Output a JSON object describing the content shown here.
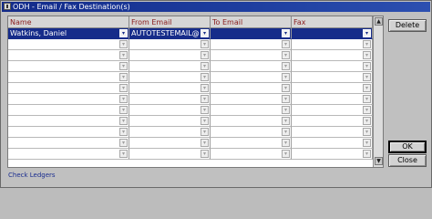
{
  "window": {
    "title": "ODH - Email / Fax Destination(s)"
  },
  "grid": {
    "columns": [
      "Name",
      "From Email",
      "To Email",
      "Fax"
    ],
    "rows": [
      {
        "name": "Watkins, Daniel",
        "from_email": "AUTOTESTEMAIL@MIC",
        "to_email": "",
        "fax": "",
        "selected": true
      },
      {
        "name": "",
        "from_email": "",
        "to_email": "",
        "fax": ""
      },
      {
        "name": "",
        "from_email": "",
        "to_email": "",
        "fax": ""
      },
      {
        "name": "",
        "from_email": "",
        "to_email": "",
        "fax": ""
      },
      {
        "name": "",
        "from_email": "",
        "to_email": "",
        "fax": ""
      },
      {
        "name": "",
        "from_email": "",
        "to_email": "",
        "fax": ""
      },
      {
        "name": "",
        "from_email": "",
        "to_email": "",
        "fax": ""
      },
      {
        "name": "",
        "from_email": "",
        "to_email": "",
        "fax": ""
      },
      {
        "name": "",
        "from_email": "",
        "to_email": "",
        "fax": ""
      },
      {
        "name": "",
        "from_email": "",
        "to_email": "",
        "fax": ""
      },
      {
        "name": "",
        "from_email": "",
        "to_email": "",
        "fax": ""
      },
      {
        "name": "",
        "from_email": "",
        "to_email": "",
        "fax": ""
      }
    ]
  },
  "buttons": {
    "delete": "Delete",
    "ok": "OK",
    "close": "Close"
  },
  "footer": {
    "check_ledgers": "Check Ledgers"
  },
  "icons": {
    "lov": "list-of-values-icon",
    "scroll_up": "scroll-up-icon",
    "scroll_down": "scroll-down-icon"
  },
  "colors": {
    "title_bar": "#1f3fa0",
    "selection": "#162c8a",
    "header_text": "#8a1c1c",
    "link": "#1a2d8f"
  }
}
